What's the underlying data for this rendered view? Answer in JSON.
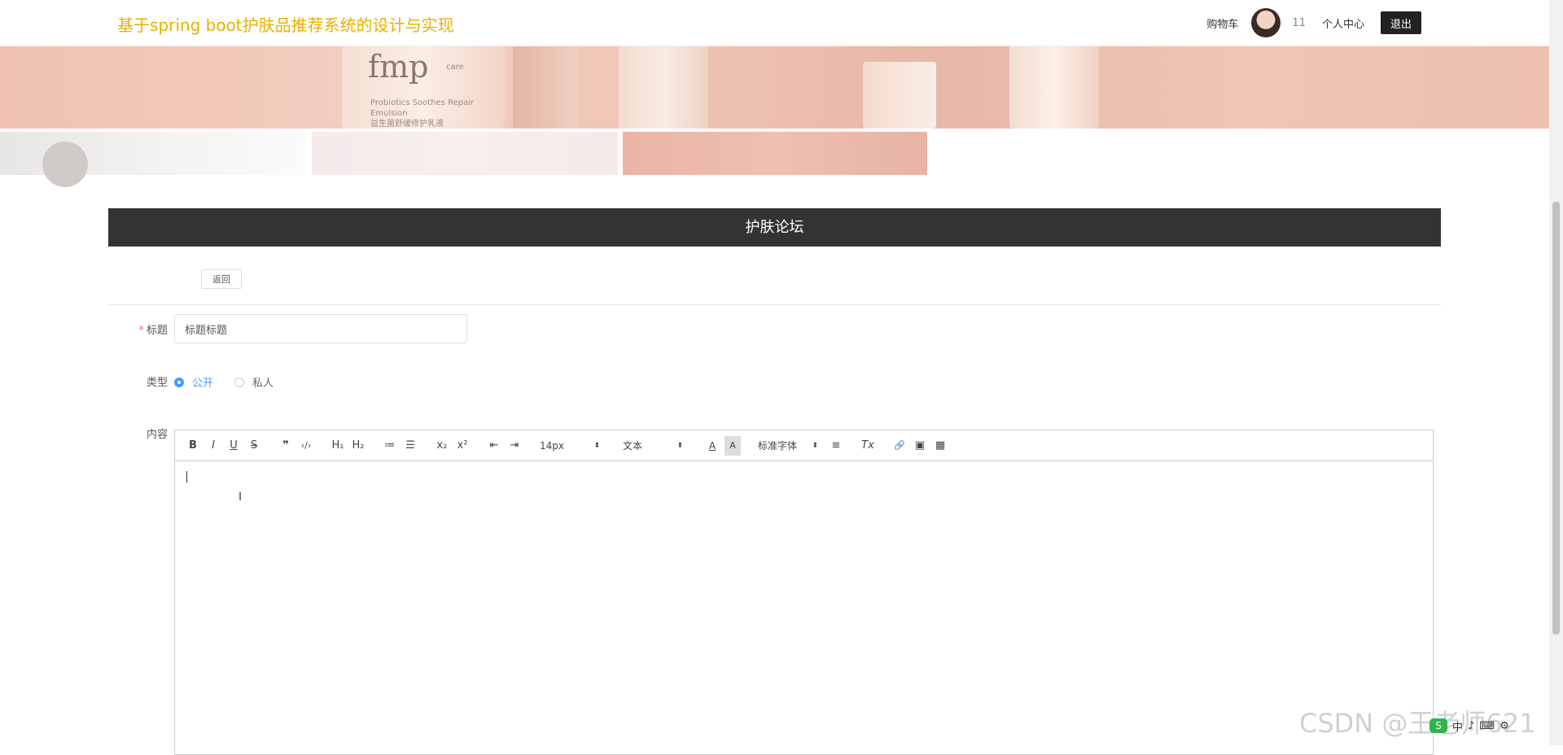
{
  "header": {
    "site_title": "基于spring boot护肤品推荐系统的设计与实现",
    "nav": {
      "cart": "购物车",
      "username": "11",
      "profile": "个人中心",
      "logout": "退出"
    }
  },
  "banner": {
    "brand": "fmp",
    "sub_brand": "care",
    "product_line1": "Probiotics Soothes Repair",
    "product_line2": "Emulsion",
    "product_line3": "益生菌舒缓修护乳液"
  },
  "section": {
    "title": "护肤论坛",
    "back_button": "返回"
  },
  "form": {
    "title_label": "标题",
    "title_required_mark": "*",
    "title_value": "标题标题",
    "type_label": "类型",
    "type_options": [
      {
        "label": "公开",
        "checked": true
      },
      {
        "label": "私人",
        "checked": false
      }
    ],
    "content_label": "内容"
  },
  "editor_toolbar": {
    "bold": "B",
    "italic": "I",
    "underline": "U",
    "strike": "S",
    "blockquote": "❞",
    "code": "‹/›",
    "h1": "H₁",
    "h2": "H₂",
    "ordered_list": "≔",
    "bullet_list": "☰",
    "subscript": "x₂",
    "superscript": "x²",
    "outdent": "⇤",
    "indent": "⇥",
    "size": "14px",
    "header": "文本",
    "font_color": "A",
    "bg_color": "A",
    "font": "标准字体",
    "align": "≡",
    "clean": "Tx",
    "link": "🔗",
    "image": "▣",
    "video": "▦"
  },
  "watermark": "CSDN @王老师621",
  "tray": {
    "logo": "S",
    "items": [
      "中",
      "♪",
      "⌨",
      "⚙"
    ]
  },
  "colors": {
    "title_gold": "#e7b100",
    "header_dark": "#333333",
    "accent_blue": "#409eff"
  }
}
